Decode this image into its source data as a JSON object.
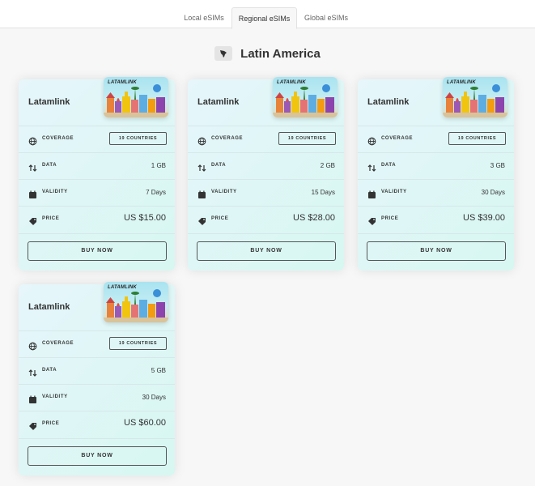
{
  "tabs": [
    {
      "label": "Local eSIMs",
      "active": false
    },
    {
      "label": "Regional eSIMs",
      "active": true
    },
    {
      "label": "Global eSIMs",
      "active": false
    }
  ],
  "region": {
    "title": "Latin America",
    "icon": "south-america-map-icon"
  },
  "labels": {
    "coverage": "COVERAGE",
    "data": "DATA",
    "validity": "VALIDITY",
    "price": "PRICE",
    "buy": "BUY NOW",
    "thumb_brand": "LATAMLINK"
  },
  "cards": [
    {
      "name": "Latamlink",
      "coverage": "19 COUNTRIES",
      "data": "1 GB",
      "validity": "7 Days",
      "price": "US $15.00"
    },
    {
      "name": "Latamlink",
      "coverage": "19 COUNTRIES",
      "data": "2 GB",
      "validity": "15 Days",
      "price": "US $28.00"
    },
    {
      "name": "Latamlink",
      "coverage": "19 COUNTRIES",
      "data": "3 GB",
      "validity": "30 Days",
      "price": "US $39.00"
    },
    {
      "name": "Latamlink",
      "coverage": "19 COUNTRIES",
      "data": "5 GB",
      "validity": "30 Days",
      "price": "US $60.00"
    }
  ],
  "colors": {
    "accent": "#333333",
    "card_gradient_start": "#e6f6fb",
    "card_gradient_end": "#d7f7f1"
  }
}
